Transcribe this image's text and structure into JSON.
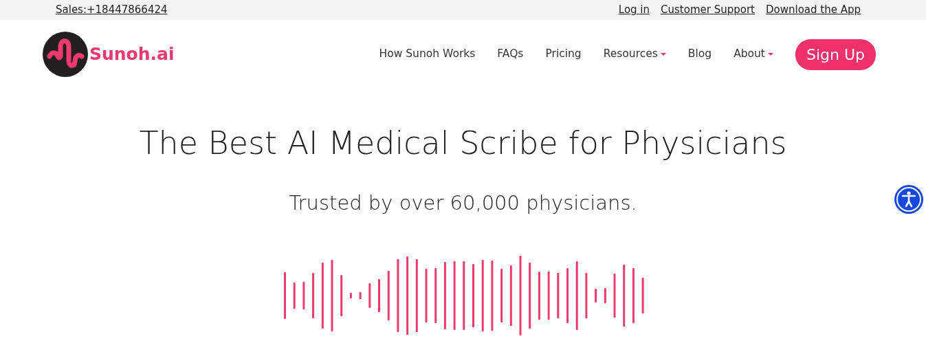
{
  "top_bar": {
    "sales": "Sales:+18447866424",
    "links": [
      {
        "label": "Log in"
      },
      {
        "label": "Customer Support"
      },
      {
        "label": "Download the App"
      }
    ]
  },
  "navbar": {
    "logo_text": "Sunoh.ai",
    "items": [
      {
        "label": "How Sunoh Works",
        "dropdown": false
      },
      {
        "label": "FAQs",
        "dropdown": false
      },
      {
        "label": "Pricing",
        "dropdown": false
      },
      {
        "label": "Resources",
        "dropdown": true
      },
      {
        "label": "Blog",
        "dropdown": false
      },
      {
        "label": "About",
        "dropdown": true
      }
    ],
    "cta": "Sign Up"
  },
  "hero": {
    "title": "The Best AI Medical Scribe for Physicians",
    "subtitle": "Trusted by over 60,000 physicians."
  }
}
